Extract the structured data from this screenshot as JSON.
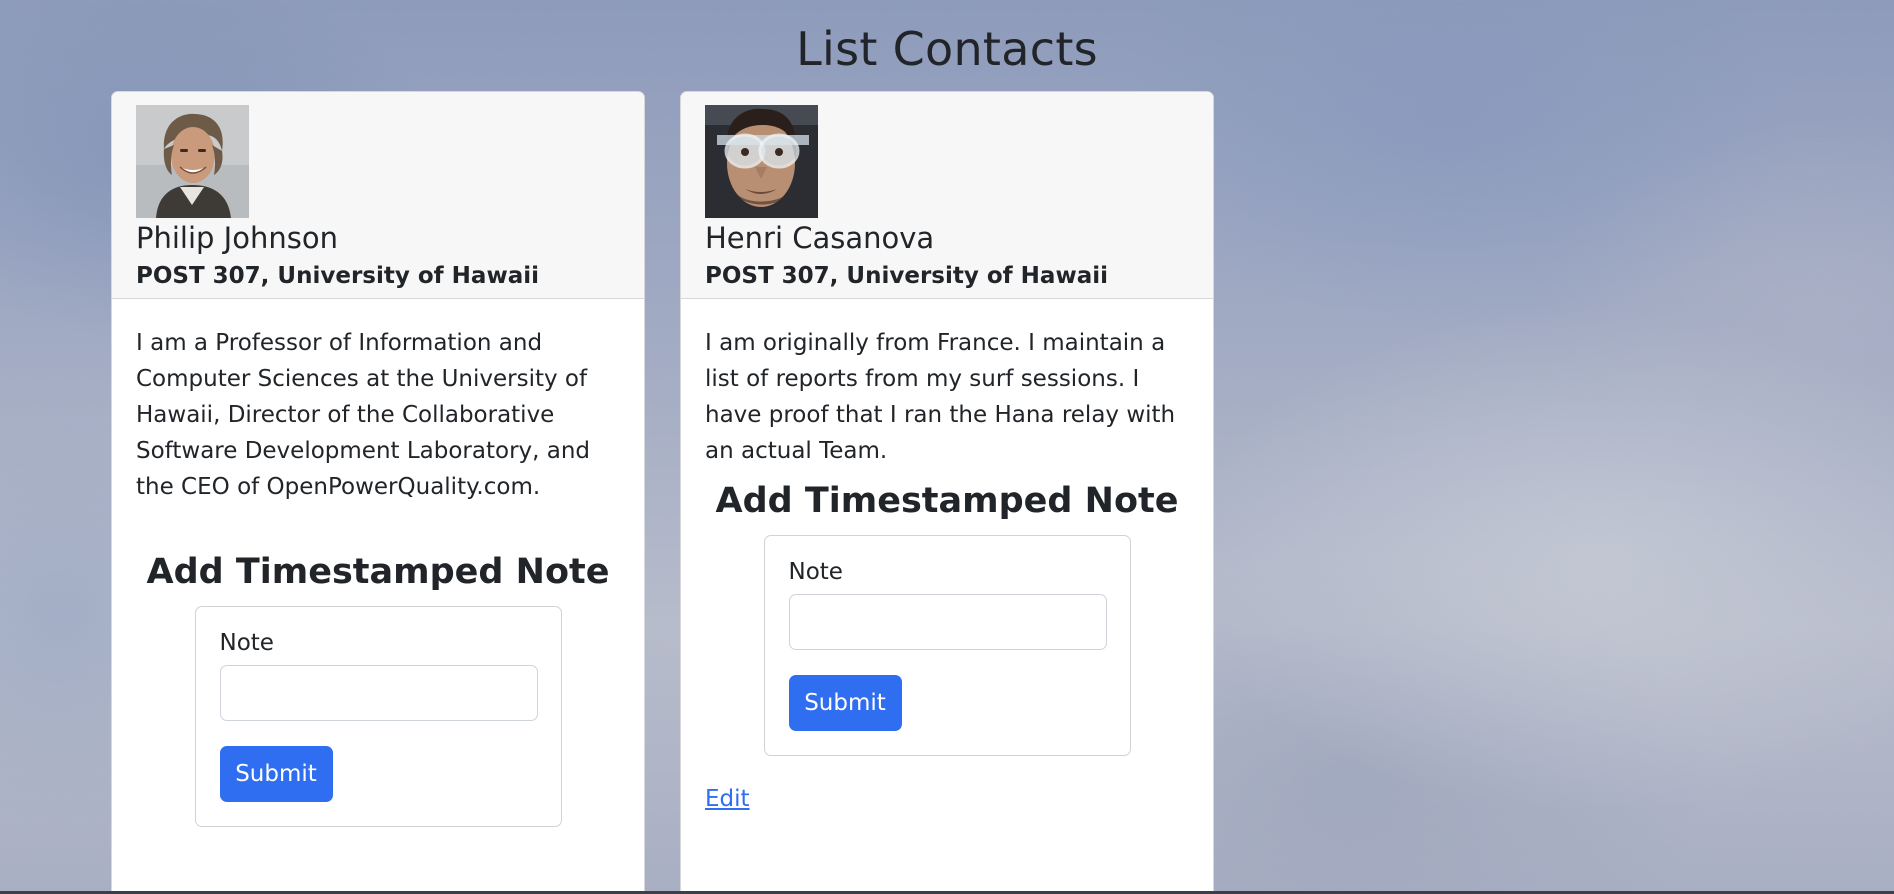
{
  "page": {
    "title": "List Contacts"
  },
  "contacts": [
    {
      "name": "Philip Johnson",
      "address": "POST 307, University of Hawaii",
      "bio": "I am a Professor of Information and Computer Sciences at the University of Hawaii, Director of the Collaborative Software Development Laboratory, and the CEO of OpenPowerQuality.com.",
      "avatar_icon": "portrait-smiling-man",
      "note_form": {
        "heading": "Add Timestamped Note",
        "label": "Note",
        "value": "",
        "submit_label": "Submit"
      }
    },
    {
      "name": "Henri Casanova",
      "address": "POST 307, University of Hawaii",
      "bio": "I am originally from France. I maintain a list of reports from my surf sessions. I have proof that I ran the Hana relay with an actual Team.",
      "avatar_icon": "portrait-man-with-goggles",
      "note_form": {
        "heading": "Add Timestamped Note",
        "label": "Note",
        "value": "",
        "submit_label": "Submit"
      },
      "edit_label": "Edit"
    }
  ],
  "colors": {
    "primary": "#2f6ef0",
    "card_header": "#f7f7f7",
    "text": "#212529"
  }
}
